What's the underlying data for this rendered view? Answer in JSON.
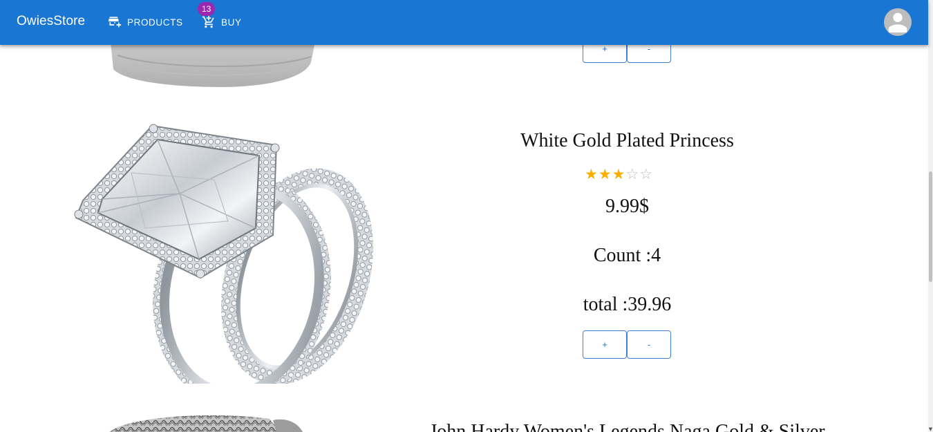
{
  "app": {
    "brand": "OwiesStore",
    "nav": [
      {
        "label": "PRODUCTS",
        "icon": "add-shopping-store-icon"
      },
      {
        "label": "BUY",
        "icon": "cart-add-icon",
        "badge": "13"
      }
    ],
    "avatar_icon": "person-icon"
  },
  "products": [
    {
      "title": "",
      "image": "grey-tshirt-hem",
      "buttons": {
        "plus": "+",
        "minus": "-"
      }
    },
    {
      "title": "White Gold Plated Princess",
      "image": "diamond-ring-set",
      "rating": 3,
      "rating_max": 5,
      "price": "9.99$",
      "count": "Count :4",
      "total": "total :39.96",
      "buttons": {
        "plus": "+",
        "minus": "-"
      }
    },
    {
      "title": "John Hardy Women's Legends Naga Gold & Silver",
      "image": "silver-chain-bracelet"
    }
  ],
  "colors": {
    "appbar": "#1976d2",
    "badge": "#9c27b0",
    "star": "#faaf00",
    "button_border": "#3f7fd6"
  }
}
